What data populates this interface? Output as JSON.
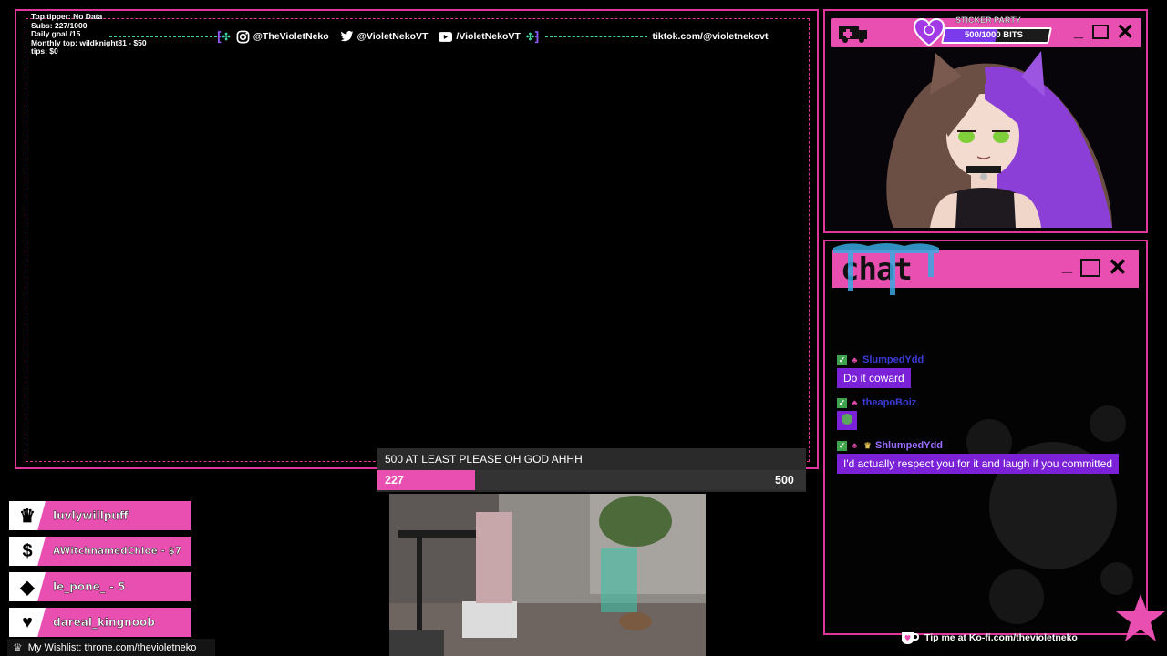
{
  "stats": {
    "top_tipper": "Top tipper: No Data",
    "subs": "Subs: 227/1000",
    "daily_goal": "Daily goal /15",
    "monthly_top": "Monthly top: wildknight81 - $50",
    "tips": "tips: $0"
  },
  "socials": {
    "instagram": "@TheVioletNeko",
    "twitter": "@VioletNekoVT",
    "youtube": "/VioletNekoVT",
    "tiktok": "tiktok.com/@violetnekovt"
  },
  "sticker": {
    "label": "STICKER PARTY",
    "bits_text": "500/1000 BITS",
    "bits_fraction": 0.5
  },
  "chat": {
    "title": "chat",
    "messages": [
      {
        "user": "SlumpedYdd",
        "user_color": "#3b3bd6",
        "text": "Do it coward"
      },
      {
        "user": "theapoBoiz",
        "user_color": "#3b3bd6",
        "text": ""
      },
      {
        "user": "ShlumpedYdd",
        "user_color": "#9b6cff",
        "text": "I'd actually respect you for it and laugh if you committed"
      }
    ]
  },
  "goal": {
    "title": "500 AT LEAST PLEASE OH GOD AHHH",
    "current": "227",
    "max": "500",
    "fraction": 0.227
  },
  "alerts": [
    {
      "icon": "crown-icon",
      "glyph": "♛",
      "text": "luvlywillpuff"
    },
    {
      "icon": "dollar-icon",
      "glyph": "$",
      "text": "AWitchnamedChloe - $7"
    },
    {
      "icon": "diamond-icon",
      "glyph": "◆",
      "text": "le_pone_ - 5"
    },
    {
      "icon": "heart-icon",
      "glyph": "♥",
      "text": "dareal_kingnoob"
    }
  ],
  "wishlist": "My Wishlist: throne.com/thevioletneko",
  "kofi": "Tip me at Ko-fi.com/thevioletneko",
  "colors": {
    "accent": "#e84fb0",
    "border": "#e0359b",
    "purple": "#7b22d9",
    "teal": "#3fd1a0"
  }
}
